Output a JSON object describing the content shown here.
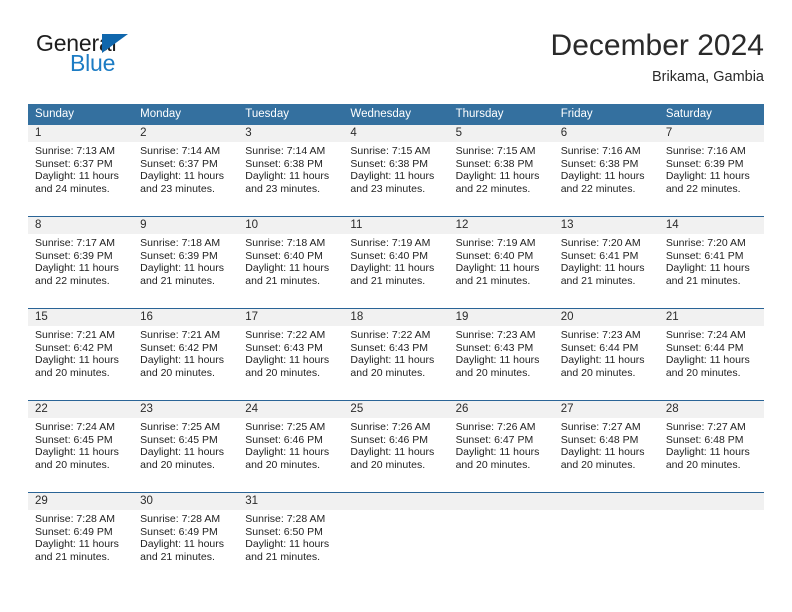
{
  "logo": {
    "word_top": "General",
    "word_bottom": "Blue",
    "triangle_color": "#1067ad",
    "blue_color": "#1c7cc4"
  },
  "header": {
    "title": "December 2024",
    "subtitle": "Brikama, Gambia"
  },
  "theme": {
    "header_bg": "#34709f",
    "row_divider": "#2a6496",
    "daynum_band_bg": "#f1f1f1",
    "page_bg": "#ffffff"
  },
  "weekday_headers": [
    "Sunday",
    "Monday",
    "Tuesday",
    "Wednesday",
    "Thursday",
    "Friday",
    "Saturday"
  ],
  "weeks": [
    [
      {
        "day": "1",
        "sunrise": "Sunrise: 7:13 AM",
        "sunset": "Sunset: 6:37 PM",
        "daylight_line1": "Daylight: 11 hours",
        "daylight_line2": "and 24 minutes."
      },
      {
        "day": "2",
        "sunrise": "Sunrise: 7:14 AM",
        "sunset": "Sunset: 6:37 PM",
        "daylight_line1": "Daylight: 11 hours",
        "daylight_line2": "and 23 minutes."
      },
      {
        "day": "3",
        "sunrise": "Sunrise: 7:14 AM",
        "sunset": "Sunset: 6:38 PM",
        "daylight_line1": "Daylight: 11 hours",
        "daylight_line2": "and 23 minutes."
      },
      {
        "day": "4",
        "sunrise": "Sunrise: 7:15 AM",
        "sunset": "Sunset: 6:38 PM",
        "daylight_line1": "Daylight: 11 hours",
        "daylight_line2": "and 23 minutes."
      },
      {
        "day": "5",
        "sunrise": "Sunrise: 7:15 AM",
        "sunset": "Sunset: 6:38 PM",
        "daylight_line1": "Daylight: 11 hours",
        "daylight_line2": "and 22 minutes."
      },
      {
        "day": "6",
        "sunrise": "Sunrise: 7:16 AM",
        "sunset": "Sunset: 6:38 PM",
        "daylight_line1": "Daylight: 11 hours",
        "daylight_line2": "and 22 minutes."
      },
      {
        "day": "7",
        "sunrise": "Sunrise: 7:16 AM",
        "sunset": "Sunset: 6:39 PM",
        "daylight_line1": "Daylight: 11 hours",
        "daylight_line2": "and 22 minutes."
      }
    ],
    [
      {
        "day": "8",
        "sunrise": "Sunrise: 7:17 AM",
        "sunset": "Sunset: 6:39 PM",
        "daylight_line1": "Daylight: 11 hours",
        "daylight_line2": "and 22 minutes."
      },
      {
        "day": "9",
        "sunrise": "Sunrise: 7:18 AM",
        "sunset": "Sunset: 6:39 PM",
        "daylight_line1": "Daylight: 11 hours",
        "daylight_line2": "and 21 minutes."
      },
      {
        "day": "10",
        "sunrise": "Sunrise: 7:18 AM",
        "sunset": "Sunset: 6:40 PM",
        "daylight_line1": "Daylight: 11 hours",
        "daylight_line2": "and 21 minutes."
      },
      {
        "day": "11",
        "sunrise": "Sunrise: 7:19 AM",
        "sunset": "Sunset: 6:40 PM",
        "daylight_line1": "Daylight: 11 hours",
        "daylight_line2": "and 21 minutes."
      },
      {
        "day": "12",
        "sunrise": "Sunrise: 7:19 AM",
        "sunset": "Sunset: 6:40 PM",
        "daylight_line1": "Daylight: 11 hours",
        "daylight_line2": "and 21 minutes."
      },
      {
        "day": "13",
        "sunrise": "Sunrise: 7:20 AM",
        "sunset": "Sunset: 6:41 PM",
        "daylight_line1": "Daylight: 11 hours",
        "daylight_line2": "and 21 minutes."
      },
      {
        "day": "14",
        "sunrise": "Sunrise: 7:20 AM",
        "sunset": "Sunset: 6:41 PM",
        "daylight_line1": "Daylight: 11 hours",
        "daylight_line2": "and 21 minutes."
      }
    ],
    [
      {
        "day": "15",
        "sunrise": "Sunrise: 7:21 AM",
        "sunset": "Sunset: 6:42 PM",
        "daylight_line1": "Daylight: 11 hours",
        "daylight_line2": "and 20 minutes."
      },
      {
        "day": "16",
        "sunrise": "Sunrise: 7:21 AM",
        "sunset": "Sunset: 6:42 PM",
        "daylight_line1": "Daylight: 11 hours",
        "daylight_line2": "and 20 minutes."
      },
      {
        "day": "17",
        "sunrise": "Sunrise: 7:22 AM",
        "sunset": "Sunset: 6:43 PM",
        "daylight_line1": "Daylight: 11 hours",
        "daylight_line2": "and 20 minutes."
      },
      {
        "day": "18",
        "sunrise": "Sunrise: 7:22 AM",
        "sunset": "Sunset: 6:43 PM",
        "daylight_line1": "Daylight: 11 hours",
        "daylight_line2": "and 20 minutes."
      },
      {
        "day": "19",
        "sunrise": "Sunrise: 7:23 AM",
        "sunset": "Sunset: 6:43 PM",
        "daylight_line1": "Daylight: 11 hours",
        "daylight_line2": "and 20 minutes."
      },
      {
        "day": "20",
        "sunrise": "Sunrise: 7:23 AM",
        "sunset": "Sunset: 6:44 PM",
        "daylight_line1": "Daylight: 11 hours",
        "daylight_line2": "and 20 minutes."
      },
      {
        "day": "21",
        "sunrise": "Sunrise: 7:24 AM",
        "sunset": "Sunset: 6:44 PM",
        "daylight_line1": "Daylight: 11 hours",
        "daylight_line2": "and 20 minutes."
      }
    ],
    [
      {
        "day": "22",
        "sunrise": "Sunrise: 7:24 AM",
        "sunset": "Sunset: 6:45 PM",
        "daylight_line1": "Daylight: 11 hours",
        "daylight_line2": "and 20 minutes."
      },
      {
        "day": "23",
        "sunrise": "Sunrise: 7:25 AM",
        "sunset": "Sunset: 6:45 PM",
        "daylight_line1": "Daylight: 11 hours",
        "daylight_line2": "and 20 minutes."
      },
      {
        "day": "24",
        "sunrise": "Sunrise: 7:25 AM",
        "sunset": "Sunset: 6:46 PM",
        "daylight_line1": "Daylight: 11 hours",
        "daylight_line2": "and 20 minutes."
      },
      {
        "day": "25",
        "sunrise": "Sunrise: 7:26 AM",
        "sunset": "Sunset: 6:46 PM",
        "daylight_line1": "Daylight: 11 hours",
        "daylight_line2": "and 20 minutes."
      },
      {
        "day": "26",
        "sunrise": "Sunrise: 7:26 AM",
        "sunset": "Sunset: 6:47 PM",
        "daylight_line1": "Daylight: 11 hours",
        "daylight_line2": "and 20 minutes."
      },
      {
        "day": "27",
        "sunrise": "Sunrise: 7:27 AM",
        "sunset": "Sunset: 6:48 PM",
        "daylight_line1": "Daylight: 11 hours",
        "daylight_line2": "and 20 minutes."
      },
      {
        "day": "28",
        "sunrise": "Sunrise: 7:27 AM",
        "sunset": "Sunset: 6:48 PM",
        "daylight_line1": "Daylight: 11 hours",
        "daylight_line2": "and 20 minutes."
      }
    ],
    [
      {
        "day": "29",
        "sunrise": "Sunrise: 7:28 AM",
        "sunset": "Sunset: 6:49 PM",
        "daylight_line1": "Daylight: 11 hours",
        "daylight_line2": "and 21 minutes."
      },
      {
        "day": "30",
        "sunrise": "Sunrise: 7:28 AM",
        "sunset": "Sunset: 6:49 PM",
        "daylight_line1": "Daylight: 11 hours",
        "daylight_line2": "and 21 minutes."
      },
      {
        "day": "31",
        "sunrise": "Sunrise: 7:28 AM",
        "sunset": "Sunset: 6:50 PM",
        "daylight_line1": "Daylight: 11 hours",
        "daylight_line2": "and 21 minutes."
      },
      {
        "day": "",
        "sunrise": "",
        "sunset": "",
        "daylight_line1": "",
        "daylight_line2": ""
      },
      {
        "day": "",
        "sunrise": "",
        "sunset": "",
        "daylight_line1": "",
        "daylight_line2": ""
      },
      {
        "day": "",
        "sunrise": "",
        "sunset": "",
        "daylight_line1": "",
        "daylight_line2": ""
      },
      {
        "day": "",
        "sunrise": "",
        "sunset": "",
        "daylight_line1": "",
        "daylight_line2": ""
      }
    ]
  ]
}
